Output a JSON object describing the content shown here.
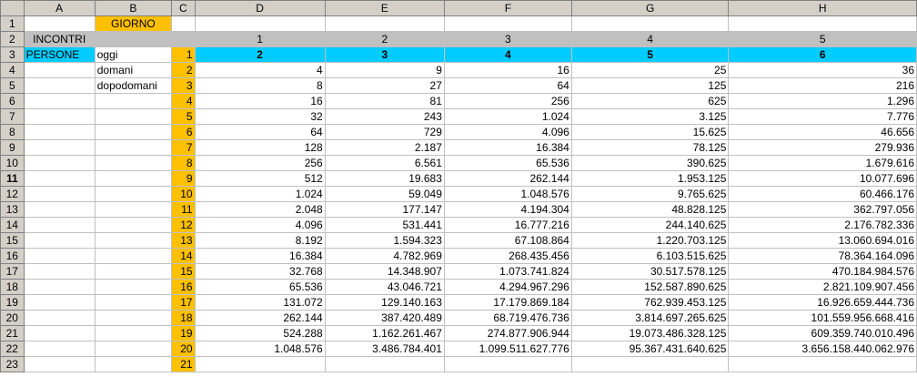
{
  "columns": [
    "A",
    "B",
    "C",
    "D",
    "E",
    "F",
    "G",
    "H"
  ],
  "rows": [
    "1",
    "2",
    "3",
    "4",
    "5",
    "6",
    "7",
    "8",
    "9",
    "10",
    "11",
    "12",
    "13",
    "14",
    "15",
    "16",
    "17",
    "18",
    "19",
    "20",
    "21",
    "22",
    "23"
  ],
  "header": {
    "giorno": "GIORNO",
    "incontri": "INCONTRI",
    "persone": "PERSONE",
    "incontri_values": [
      "1",
      "2",
      "3",
      "4",
      "5"
    ],
    "persone_values": [
      "2",
      "3",
      "4",
      "5",
      "6"
    ]
  },
  "labels": {
    "oggi": "oggi",
    "domani": "domani",
    "dopodomani": "dopodomani"
  },
  "c_values": [
    "1",
    "2",
    "3",
    "4",
    "5",
    "6",
    "7",
    "8",
    "9",
    "10",
    "11",
    "12",
    "13",
    "14",
    "15",
    "16",
    "17",
    "18",
    "19",
    "20",
    "21"
  ],
  "grid": [
    [
      "4",
      "9",
      "16",
      "25",
      "36"
    ],
    [
      "8",
      "27",
      "64",
      "125",
      "216"
    ],
    [
      "16",
      "81",
      "256",
      "625",
      "1.296"
    ],
    [
      "32",
      "243",
      "1.024",
      "3.125",
      "7.776"
    ],
    [
      "64",
      "729",
      "4.096",
      "15.625",
      "46.656"
    ],
    [
      "128",
      "2.187",
      "16.384",
      "78.125",
      "279.936"
    ],
    [
      "256",
      "6.561",
      "65.536",
      "390.625",
      "1.679.616"
    ],
    [
      "512",
      "19.683",
      "262.144",
      "1.953.125",
      "10.077.696"
    ],
    [
      "1.024",
      "59.049",
      "1.048.576",
      "9.765.625",
      "60.466.176"
    ],
    [
      "2.048",
      "177.147",
      "4.194.304",
      "48.828.125",
      "362.797.056"
    ],
    [
      "4.096",
      "531.441",
      "16.777.216",
      "244.140.625",
      "2.176.782.336"
    ],
    [
      "8.192",
      "1.594.323",
      "67.108.864",
      "1.220.703.125",
      "13.060.694.016"
    ],
    [
      "16.384",
      "4.782.969",
      "268.435.456",
      "6.103.515.625",
      "78.364.164.096"
    ],
    [
      "32.768",
      "14.348.907",
      "1.073.741.824",
      "30.517.578.125",
      "470.184.984.576"
    ],
    [
      "65.536",
      "43.046.721",
      "4.294.967.296",
      "152.587.890.625",
      "2.821.109.907.456"
    ],
    [
      "131.072",
      "129.140.163",
      "17.179.869.184",
      "762.939.453.125",
      "16.926.659.444.736"
    ],
    [
      "262.144",
      "387.420.489",
      "68.719.476.736",
      "3.814.697.265.625",
      "101.559.956.668.416"
    ],
    [
      "524.288",
      "1.162.261.467",
      "274.877.906.944",
      "19.073.486.328.125",
      "609.359.740.010.496"
    ],
    [
      "1.048.576",
      "3.486.784.401",
      "1.099.511.627.776",
      "95.367.431.640.625",
      "3.656.158.440.062.976"
    ]
  ],
  "colors": {
    "orange": "#ffc000",
    "gray": "#c0c0c0",
    "cyan": "#00ccff"
  }
}
